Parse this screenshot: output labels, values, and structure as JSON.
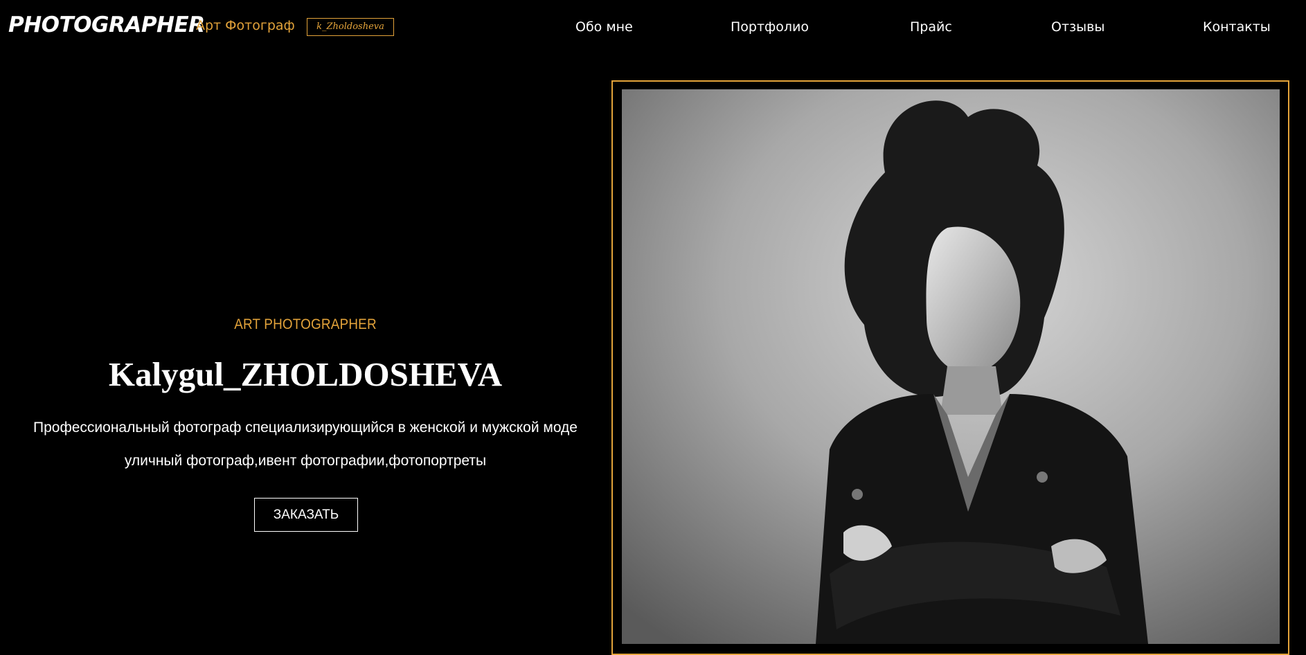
{
  "header": {
    "logo": "PHOTOGRAPHER",
    "subtitle": "Арт Фотограф",
    "signature": "k_Zholdosheva",
    "nav": [
      {
        "label": "Обо мне"
      },
      {
        "label": "Портфолио"
      },
      {
        "label": "Прайс"
      },
      {
        "label": "Отзывы"
      },
      {
        "label": "Контакты"
      }
    ]
  },
  "hero": {
    "tagline": "ART PHOTOGRAPHER",
    "name": "Kalygul_ZHOLDOSHEVA",
    "description_line1": "Профессиональный фотограф специализирующийся в женской и мужской моде",
    "description_line2": "уличный фотограф,ивент фотографии,фотопортреты",
    "order_button": "ЗАКАЗАТЬ"
  },
  "colors": {
    "background": "#000000",
    "accent": "#e3a33a",
    "text": "#ffffff"
  }
}
